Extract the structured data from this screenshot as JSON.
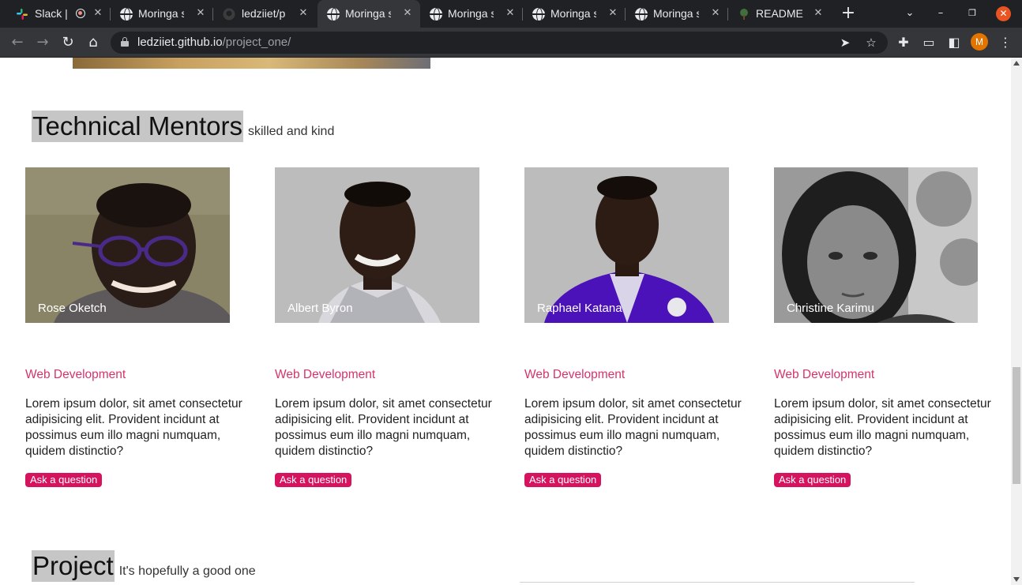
{
  "browser": {
    "tabs": [
      {
        "title": "Slack | ",
        "icon": "slack-icon",
        "active": false
      },
      {
        "title": "Moringa s",
        "icon": "globe-icon",
        "active": false
      },
      {
        "title": "ledziiet/p",
        "icon": "github-icon",
        "active": false
      },
      {
        "title": "Moringa s",
        "icon": "globe-icon",
        "active": true
      },
      {
        "title": "Moringa s",
        "icon": "globe-icon",
        "active": false
      },
      {
        "title": "Moringa s",
        "icon": "globe-icon",
        "active": false
      },
      {
        "title": "Moringa s",
        "icon": "globe-icon",
        "active": false
      },
      {
        "title": "README",
        "icon": "tree-icon",
        "active": false
      }
    ],
    "url_host": "ledziiet.github.io",
    "url_path": "/project_one/",
    "profile_initial": "M",
    "accent_close": "#e95420"
  },
  "mentors_section": {
    "title": "Technical Mentors",
    "subtitle": "skilled and kind"
  },
  "mentors": [
    {
      "name": "Rose Oketch",
      "role": "Web Development",
      "description": "Lorem ipsum dolor, sit amet consectetur adipisicing elit. Provident incidunt at possimus eum illo magni numquam, quidem distinctio?",
      "button": "Ask a question"
    },
    {
      "name": "Albert Byron",
      "role": "Web Development",
      "description": "Lorem ipsum dolor, sit amet consectetur adipisicing elit. Provident incidunt at possimus eum illo magni numquam, quidem distinctio?",
      "button": "Ask a question"
    },
    {
      "name": "Raphael Katana",
      "role": "Web Development",
      "description": "Lorem ipsum dolor, sit amet consectetur adipisicing elit. Provident incidunt at possimus eum illo magni numquam, quidem distinctio?",
      "button": "Ask a question"
    },
    {
      "name": "Christine Karimu",
      "role": "Web Development",
      "description": "Lorem ipsum dolor, sit amet consectetur adipisicing elit. Provident incidunt at possimus eum illo magni numquam, quidem distinctio?",
      "button": "Ask a question"
    }
  ],
  "project_section": {
    "title": "Project",
    "subtitle": "It's hopefully a good one"
  },
  "colors": {
    "accent": "#d6135f",
    "role_text": "#d6336c",
    "title_highlight": "#c6c6c6"
  }
}
